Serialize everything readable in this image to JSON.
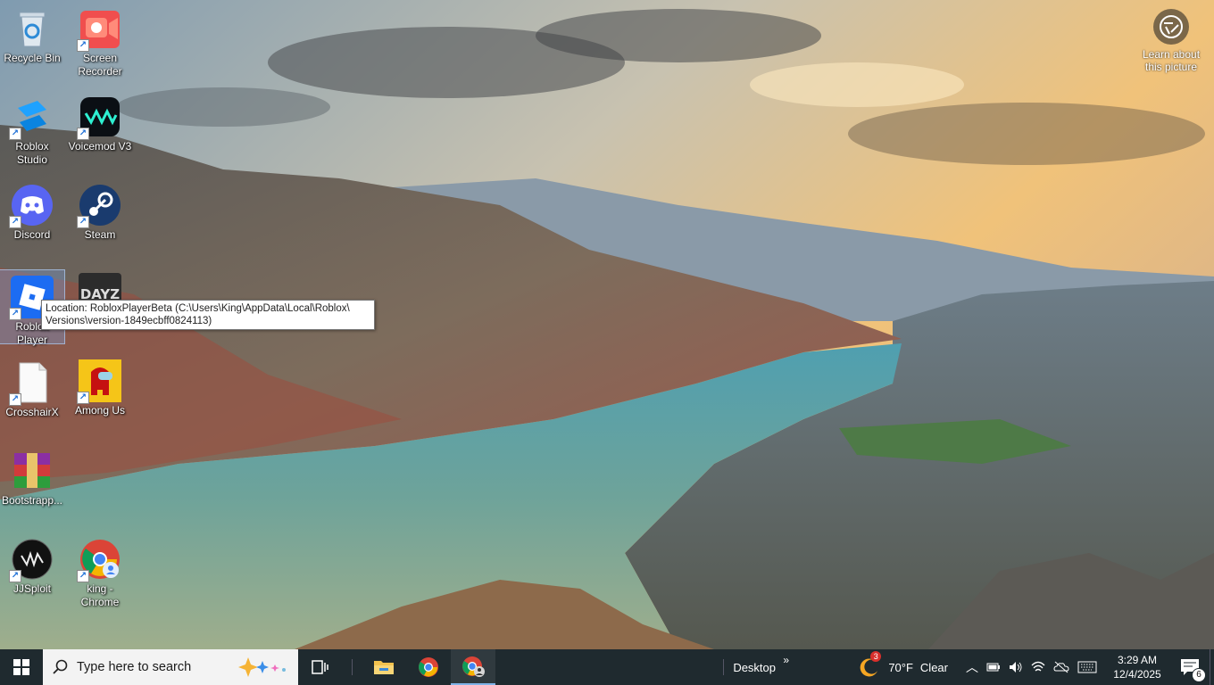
{
  "desktop": {
    "icons": [
      {
        "label": "Recycle Bin"
      },
      {
        "label": "Screen Recorder"
      },
      {
        "label": "Roblox Studio"
      },
      {
        "label": "Voicemod V3"
      },
      {
        "label": "Discord"
      },
      {
        "label": "Steam"
      },
      {
        "label": "Roblox Player"
      },
      {
        "label": "DAYZ"
      },
      {
        "label": "CrosshairX"
      },
      {
        "label": "Among Us"
      },
      {
        "label": "Bootstrapp..."
      },
      {
        "label": "JJSploit"
      },
      {
        "label": "king - Chrome"
      }
    ],
    "tooltip": {
      "line1": "Location: RobloxPlayerBeta (C:\\Users\\King\\AppData\\Local\\Roblox\\",
      "line2": "Versions\\version-1849ecbff0824113)"
    },
    "learn": {
      "label": "Learn about this picture"
    }
  },
  "taskbar": {
    "search_placeholder": "Type here to search",
    "desktop_label": "Desktop",
    "weather": {
      "temp": "70°F",
      "condition": "Clear",
      "badge": "3"
    },
    "clock": {
      "time": "3:29 AM",
      "date": "12/4/2025"
    },
    "notifications_count": "6"
  },
  "colors": {
    "taskbar": "#1f2a2f",
    "search_bg": "#f3f3f3",
    "accent": "#7fb3e8"
  }
}
